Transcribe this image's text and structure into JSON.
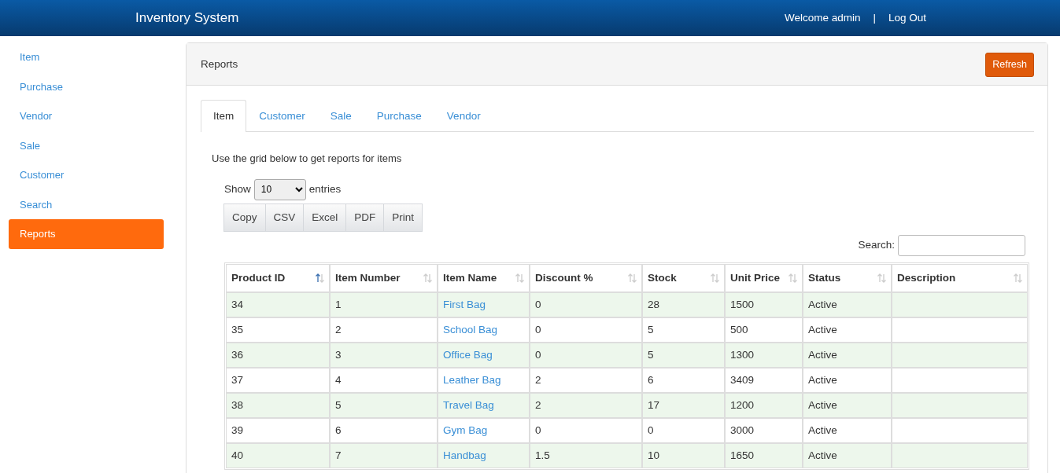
{
  "navbar": {
    "brand": "Inventory System",
    "welcome": "Welcome admin",
    "separator": "|",
    "logout": "Log Out"
  },
  "sidebar": {
    "items": [
      {
        "label": "Item",
        "selected": false
      },
      {
        "label": "Purchase",
        "selected": false
      },
      {
        "label": "Vendor",
        "selected": false
      },
      {
        "label": "Sale",
        "selected": false
      },
      {
        "label": "Customer",
        "selected": false
      },
      {
        "label": "Search",
        "selected": false
      },
      {
        "label": "Reports",
        "selected": true
      }
    ]
  },
  "panel": {
    "title": "Reports",
    "refresh": "Refresh"
  },
  "tabs": [
    {
      "label": "Item",
      "selected": true
    },
    {
      "label": "Customer",
      "selected": false
    },
    {
      "label": "Sale",
      "selected": false
    },
    {
      "label": "Purchase",
      "selected": false
    },
    {
      "label": "Vendor",
      "selected": false
    }
  ],
  "intro": "Use the grid below to get reports for items",
  "length": {
    "before": "Show",
    "value": "10",
    "after": "entries"
  },
  "export_buttons": [
    "Copy",
    "CSV",
    "Excel",
    "PDF",
    "Print"
  ],
  "search": {
    "label": "Search:"
  },
  "table": {
    "columns": [
      {
        "label": "Product ID",
        "sorted": true
      },
      {
        "label": "Item Number",
        "sorted": false
      },
      {
        "label": "Item Name",
        "sorted": false
      },
      {
        "label": "Discount %",
        "sorted": false
      },
      {
        "label": "Stock",
        "sorted": false
      },
      {
        "label": "Unit Price",
        "sorted": false
      },
      {
        "label": "Status",
        "sorted": false
      },
      {
        "label": "Description",
        "sorted": false
      }
    ],
    "rows": [
      [
        "34",
        "1",
        "First Bag",
        "0",
        "28",
        "1500",
        "Active",
        ""
      ],
      [
        "35",
        "2",
        "School Bag",
        "0",
        "5",
        "500",
        "Active",
        ""
      ],
      [
        "36",
        "3",
        "Office Bag",
        "0",
        "5",
        "1300",
        "Active",
        ""
      ],
      [
        "37",
        "4",
        "Leather Bag",
        "2",
        "6",
        "3409",
        "Active",
        ""
      ],
      [
        "38",
        "5",
        "Travel Bag",
        "2",
        "17",
        "1200",
        "Active",
        ""
      ],
      [
        "39",
        "6",
        "Gym Bag",
        "0",
        "0",
        "3000",
        "Active",
        ""
      ],
      [
        "40",
        "7",
        "Handbag",
        "1.5",
        "10",
        "1650",
        "Active",
        ""
      ]
    ]
  }
}
